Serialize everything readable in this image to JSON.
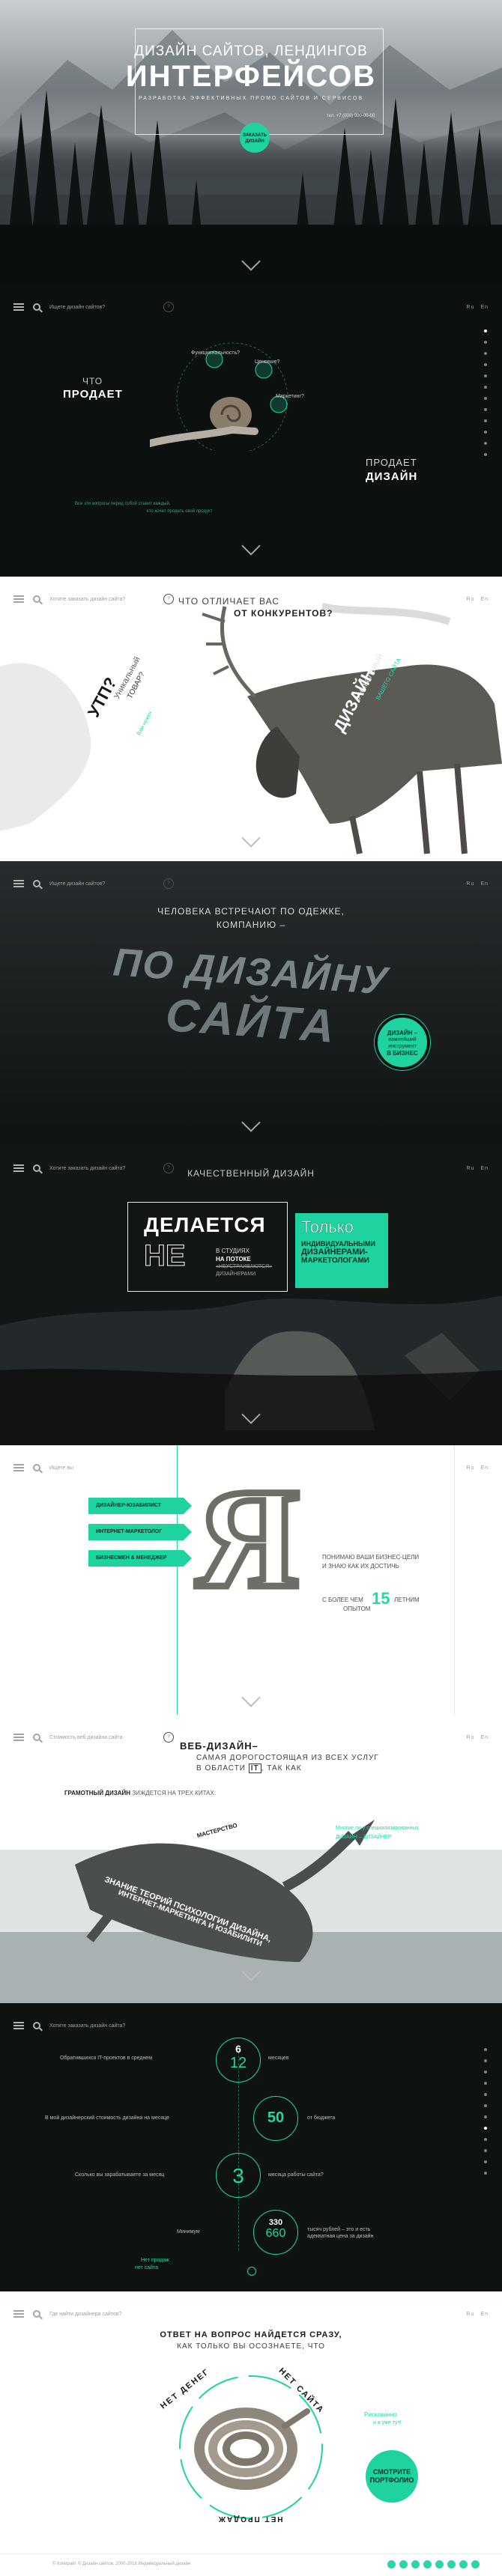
{
  "hero": {
    "pretitle": "ДИЗАЙН САЙТОВ, ЛЕНДИНГОВ",
    "title": "ИНТЕРФЕЙСОВ",
    "subtitle": "РАЗРАБОТКА ЭФФЕКТИВНЫХ ПРОМО САЙТОВ И СЕРВИСОВ",
    "order_line1": "ЗАКАЗАТЬ",
    "order_line2": "ДИЗАЙН",
    "phone_label": "тел. +7 (000) 000-00-00"
  },
  "nav": {
    "search_placeholder": "Ищете дизайн сайтов?",
    "search_placeholder_alt": "Хотите заказать дизайн сайта?",
    "search_placeholder_plain": "Ищете вы",
    "search_placeholder_web": "Стоимость веб дизайна сайта",
    "search_placeholder_last": "Где найти дизайнера сайтов?",
    "qbtn": "?",
    "lang_ru": "Ru",
    "lang_en": "En"
  },
  "sell": {
    "what_label": "ЧТО",
    "sells": "ПРОДАЕТ",
    "right_line1": "ПРОДАЕТ",
    "right_line2": "ДИЗАЙН",
    "bubble_functionality": "Функциональность?",
    "bubble_price": "Ценовые?",
    "bubble_marketing": "Маркетинг?",
    "bottom_note_1": "Все эти вопросы перед собой ставит каждый,",
    "bottom_note_2": "кто хочет продать свой продукт"
  },
  "unique": {
    "question_line1": "ЧТО ОТЛИЧАЕТ ВАС",
    "question_line2": "ОТ КОНКУРЕНТОВ?",
    "utp": "УТП?",
    "utp_sub": "Уникальный",
    "utp_sub2": "ТОВАР?",
    "utp_note": "Вам нужен",
    "right_tag": "Уникальный",
    "right_big": "ДИЗАЙН",
    "right_teal": "ВАШЕГО САЙТА"
  },
  "clothes": {
    "line1": "ЧЕЛОВЕКА ВСТРЕЧАЮТ ПО ОДЕЖКЕ,",
    "line2": "КОМПАНИЮ –",
    "big1": "ПО ДИЗАЙНУ",
    "big2": "САЙТА",
    "badge1": "ДИЗАЙН –",
    "badge2": "важнейший",
    "badge3": "инструмент",
    "badge4": "В БИЗНЕС"
  },
  "quality": {
    "heading": "КАЧЕСТВЕННЫЙ ДИЗАЙН",
    "made": "ДЕЛАЕТСЯ",
    "not": "НЕ",
    "in_studio": "В СТУДИЯХ",
    "on_stream": "НА ПОТОКЕ",
    "crossed": "«НЕУСТРАИВАЮТСЯ»",
    "designers": "ДИЗАЙНЕРАМИ",
    "only": "Только",
    "individual": "ИНДИВИДУАЛЬНЫМИ",
    "designers2": "ДИЗАЙНЕРАМИ-",
    "marketers": "МАРКЕТОЛОГАМИ"
  },
  "me": {
    "role1": "ДИЗАЙНЕР-ЮЗАБИЛИСТ",
    "role2": "ИНТЕРНЕТ-МАРКЕТОЛОГ",
    "role3": "БИЗНЕСМЕН & МЕНЕДЖЕР",
    "letter": "Я",
    "text1": "ПОНИМАЮ ВАШИ БИЗНЕС-ЦЕЛИ",
    "text2": "И ЗНАЮ КАК ИХ ДОСТИЧЬ",
    "exp1": "С БОЛЕЕ ЧЕМ",
    "exp_num": "15",
    "exp2": "ЛЕТНИМ",
    "exp3": "ОПЫТОМ"
  },
  "whale": {
    "title": "ВЕБ-ДИЗАЙН–",
    "line2": "САМАЯ ДОРОГОСТОЯЩАЯ ИЗ ВСЕХ УСЛУГ",
    "line3a": "В ОБЛАСТИ",
    "line3b": "IT",
    "line3c": ", ТАК КАК",
    "good": "ГРАМОТНЫЙ ДИЗАЙН",
    "good_rest": "ЗИЖДЕТСЯ НА ТРЕХ КИТАХ:",
    "whale1": "ЗНАНИЕ ТЕОРИЙ ПСИХОЛОГИИ ДИЗАЙНА,",
    "whale2": "ИНТЕРНЕТ-МАРКЕТИНГА И ЮЗАБИЛИТИ",
    "whale3": "МАСТЕРСТВО",
    "side1": "Многие ли у специализированных",
    "side2": "ДИЗАЙН – ДИЗАЙНЕР"
  },
  "stats": {
    "r1_text": "Обратившихся IT-проектов в среднем",
    "r1_top": "6",
    "r1_bottom": "12",
    "r1_tail": "месяцев",
    "r2_text": "В мой дизайнерский стоимость дизайна на месяце",
    "r2_num": "50",
    "r2_tail": "от бюджета",
    "r3_text": "Сколько вы зарабатываете за месяц",
    "r3_num": "3",
    "r3_tail": "месяца работы сайта?",
    "r4_text": "Минимум",
    "r4_top": "330",
    "r4_bottom": "660",
    "r4_tail": "тысяч рублей – это и есть адекватная цена за дизайн",
    "foot1": "Нет продаж",
    "foot2": "нет сайта"
  },
  "final": {
    "heading1": "ОТВЕТ НА ВОПРОС НАЙДЕТСЯ СРАЗУ,",
    "heading2": "КАК ТОЛЬКО ВЫ ОСОЗНАЕТЕ, ЧТО",
    "ring_top": "НЕТ ДЕНЕГ",
    "ring_right": "НЕТ САЙТА",
    "ring_bottom": "НЕТ ПРОДАЖ",
    "side1": "Рискованно",
    "side2": "и я уже тут!",
    "cta1": "СМОТРИТЕ",
    "cta2": "ПОРТФОЛИО",
    "footer": "© Копирайт © Дизайн сайтов, 2000-2018 Индивидуальный дизайн"
  },
  "colors": {
    "accent": "#25d8a7",
    "dark": "#0f1412",
    "muted": "#9aa09d"
  }
}
